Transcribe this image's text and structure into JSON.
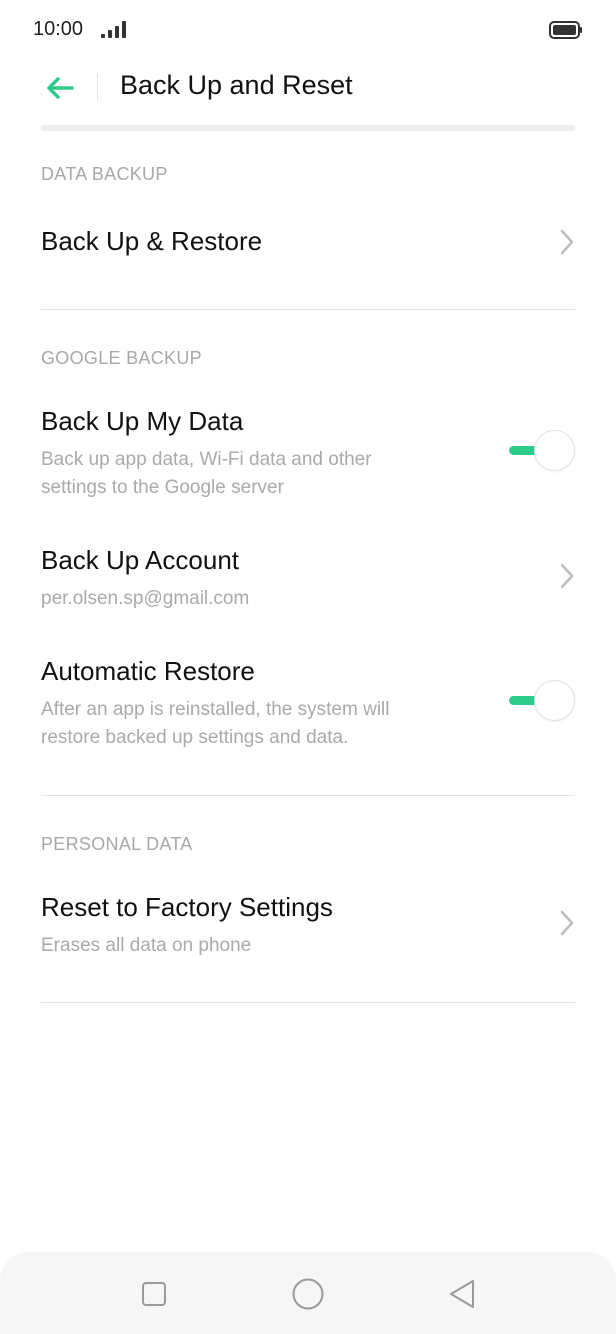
{
  "status_bar": {
    "time": "10:00"
  },
  "header": {
    "title": "Back Up and Reset"
  },
  "sections": {
    "data_backup": {
      "header": "DATA BACKUP",
      "items": [
        {
          "title": "Back Up & Restore"
        }
      ]
    },
    "google_backup": {
      "header": "GOOGLE BACKUP",
      "back_up_my_data": {
        "title": "Back Up My Data",
        "subtitle": "Back up app data, Wi-Fi data and other settings to the Google server",
        "enabled": true
      },
      "back_up_account": {
        "title": "Back Up Account",
        "subtitle": "per.olsen.sp@gmail.com"
      },
      "automatic_restore": {
        "title": "Automatic Restore",
        "subtitle": "After an app is reinstalled, the system will restore backed up settings and data.",
        "enabled": true
      }
    },
    "personal_data": {
      "header": "PERSONAL DATA",
      "reset": {
        "title": "Reset to Factory Settings",
        "subtitle": "Erases all data on phone"
      }
    }
  },
  "colors": {
    "accent": "#2ecc8a",
    "section_header": "#a8a8a8",
    "subtitle": "#aaaaaa"
  },
  "icons": {
    "back": "back-arrow-icon",
    "chevron": "chevron-right-icon",
    "signal": "signal-icon",
    "battery": "battery-icon",
    "nav_recents": "square-icon",
    "nav_home": "circle-icon",
    "nav_back": "triangle-back-icon"
  }
}
